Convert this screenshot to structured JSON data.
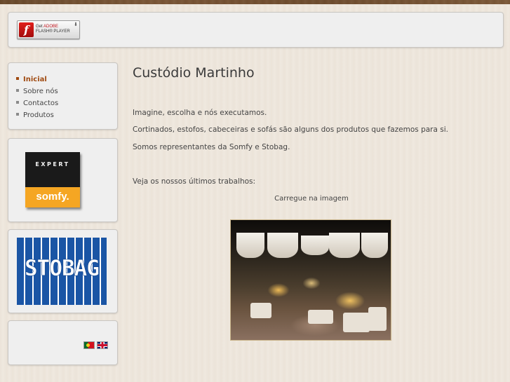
{
  "header": {
    "flash_badge": {
      "line1_prefix": "Get",
      "line1_brand": "ADOBE",
      "line2": "FLASH® PLAYER",
      "logo_letter": "f",
      "download_glyph": "⬇"
    }
  },
  "sidebar": {
    "menu": [
      {
        "label": "Inicial",
        "active": true
      },
      {
        "label": "Sobre nós",
        "active": false
      },
      {
        "label": "Contactos",
        "active": false
      },
      {
        "label": "Produtos",
        "active": false
      }
    ],
    "somfy": {
      "top_text": "EXPERT",
      "brand_text": "somfy."
    },
    "stobag": {
      "text": "STOBAG"
    },
    "languages": [
      {
        "code": "pt",
        "icon": "flag-portugal-icon"
      },
      {
        "code": "en",
        "icon": "flag-uk-icon"
      }
    ]
  },
  "main": {
    "title": "Custódio Martinho",
    "paragraphs": [
      "Imagine, escolha e nós executamos.",
      "Cortinados, estofos, cabeceiras e sofás são alguns dos produtos que fazemos para si.",
      "Somos representantes da Somfy e Stobag.",
      "Veja os nossos últimos trabalhos:"
    ],
    "caption": "Carregue na imagem"
  },
  "colors": {
    "accent": "#a04b12",
    "panel": "#efefef",
    "page_bg": "#efe8df",
    "somfy_orange": "#f5a623",
    "stobag_blue": "#1a55a5"
  }
}
